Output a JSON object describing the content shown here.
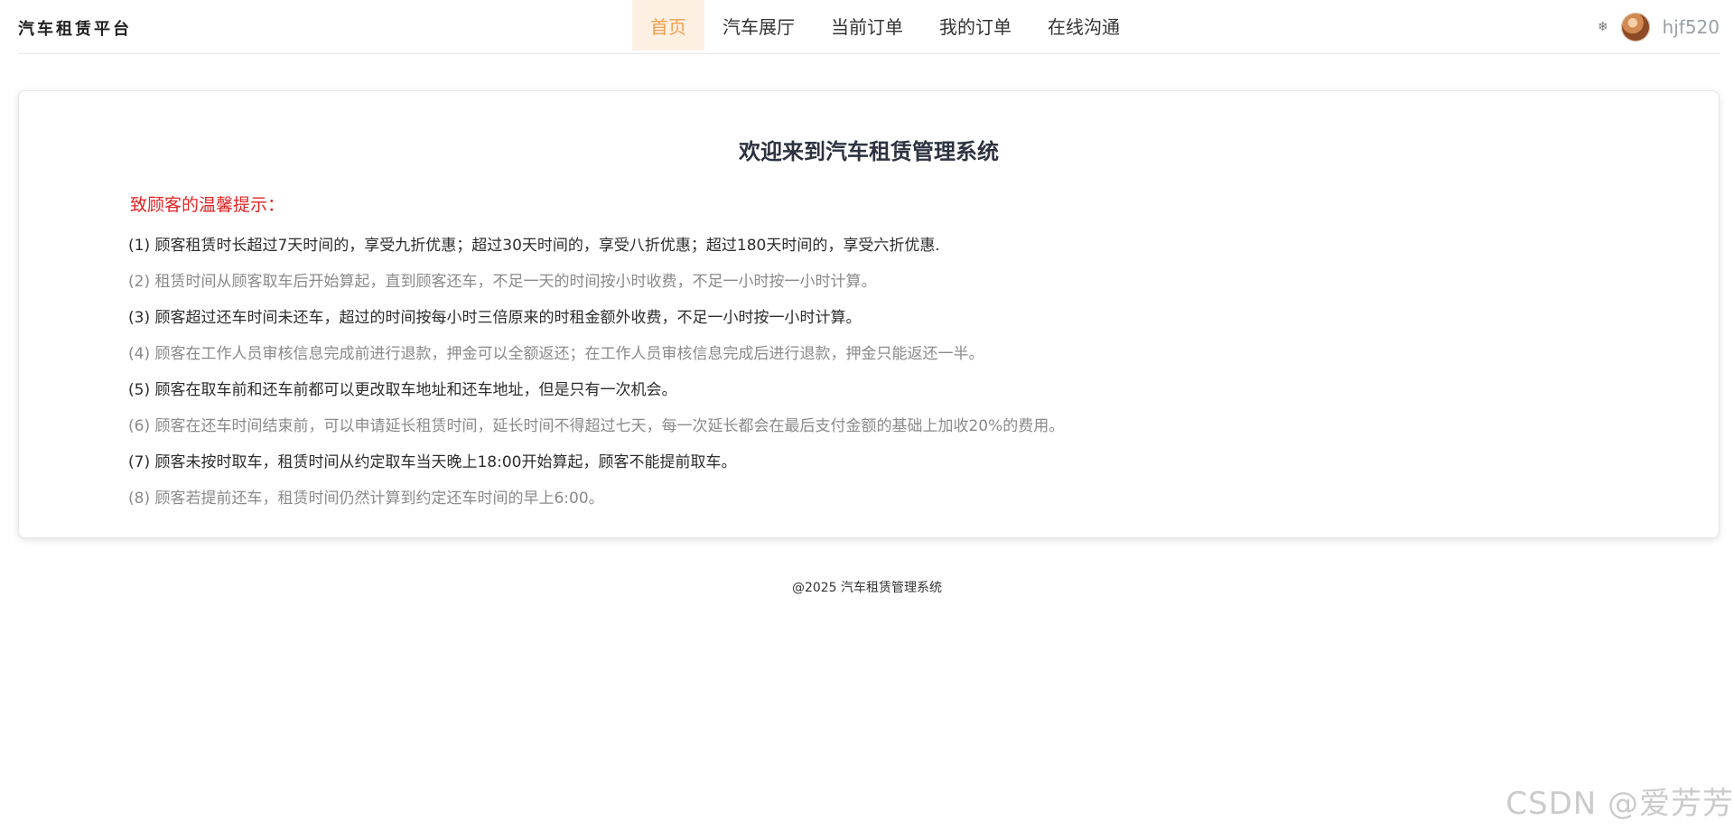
{
  "app": {
    "brand": "汽车租赁平台"
  },
  "nav": {
    "items": [
      {
        "label": "首页",
        "active": true
      },
      {
        "label": "汽车展厅",
        "active": false
      },
      {
        "label": "当前订单",
        "active": false
      },
      {
        "label": "我的订单",
        "active": false
      },
      {
        "label": "在线沟通",
        "active": false
      }
    ]
  },
  "user": {
    "name": "hjf520",
    "icon_gear": "gear-icon",
    "avatar": "avatar"
  },
  "card": {
    "title": "欢迎来到汽车租赁管理系统",
    "notice_title": "致顾客的温馨提示：",
    "tips": [
      "(1) 顾客租赁时长超过7天时间的，享受九折优惠；超过30天时间的，享受八折优惠；超过180天时间的，享受六折优惠.",
      "(2) 租赁时间从顾客取车后开始算起，直到顾客还车，不足一天的时间按小时收费，不足一小时按一小时计算。",
      "(3) 顾客超过还车时间未还车，超过的时间按每小时三倍原来的时租金额外收费，不足一小时按一小时计算。",
      "(4) 顾客在工作人员审核信息完成前进行退款，押金可以全额返还；在工作人员审核信息完成后进行退款，押金只能返还一半。",
      "(5) 顾客在取车前和还车前都可以更改取车地址和还车地址，但是只有一次机会。",
      "(6) 顾客在还车时间结束前，可以申请延长租赁时间，延长时间不得超过七天，每一次延长都会在最后支付金额的基础上加收20%的费用。",
      "(7) 顾客未按时取车，租赁时间从约定取车当天晚上18:00开始算起，顾客不能提前取车。",
      "(8) 顾客若提前还车，租赁时间仍然计算到约定还车时间的早上6:00。"
    ]
  },
  "footer": {
    "text": "@2025 汽车租赁管理系统"
  },
  "watermark": {
    "text": "CSDN @爱芳芳"
  },
  "colors": {
    "nav_active_bg": "#fdf0e3",
    "nav_active_text": "#f0a050",
    "notice_red": "#e22424"
  }
}
